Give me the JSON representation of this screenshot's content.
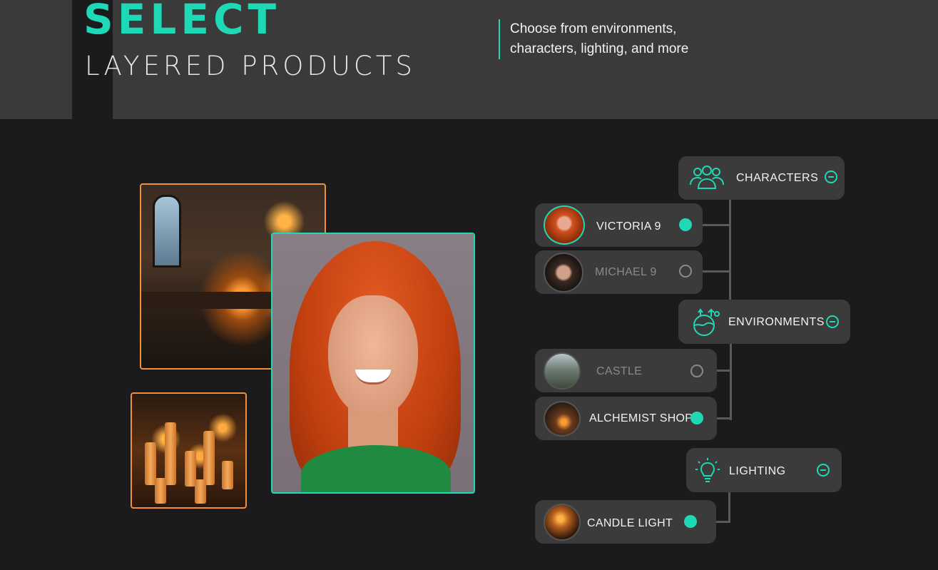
{
  "header": {
    "title": "SELECT",
    "subtitle": "LAYERED PRODUCTS",
    "tagline_line1": "Choose from environments,",
    "tagline_line2": "characters, lighting, and more"
  },
  "colors": {
    "accent": "#1fd8b6",
    "orange_frame": "#f0913a",
    "panel": "#3b3b3b",
    "background": "#1b1b1d"
  },
  "categories": [
    {
      "label": "CHARACTERS",
      "icon": "group-icon",
      "items": [
        {
          "label": "VICTORIA 9",
          "selected": true
        },
        {
          "label": "MICHAEL 9",
          "selected": false
        }
      ]
    },
    {
      "label": "ENVIRONMENTS",
      "icon": "landscape-icon",
      "items": [
        {
          "label": "CASTLE",
          "selected": false
        },
        {
          "label": "ALCHEMIST SHOP",
          "selected": true
        }
      ]
    },
    {
      "label": "LIGHTING",
      "icon": "lightbulb-icon",
      "items": [
        {
          "label": "CANDLE LIGHT",
          "selected": true
        }
      ]
    }
  ]
}
